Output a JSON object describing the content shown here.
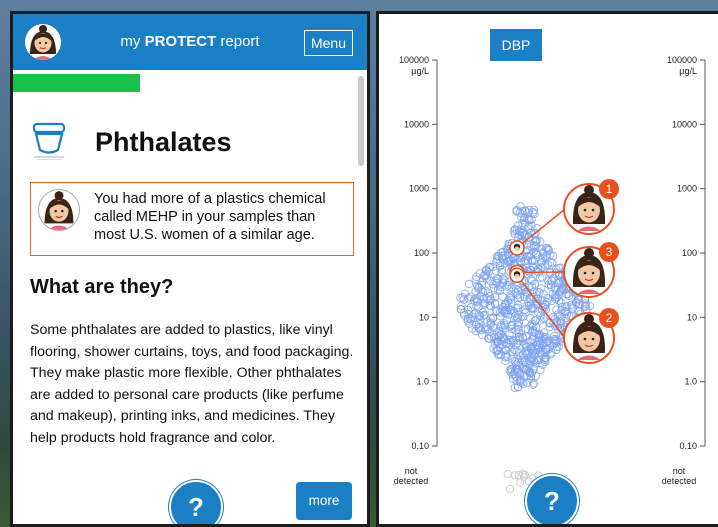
{
  "header": {
    "title_prefix": "my ",
    "title_bold": "PROTECT",
    "title_suffix": " report",
    "menu_label": "Menu",
    "color": "#1a7fc4"
  },
  "progress": {
    "fraction": 0.36,
    "color": "#17c24a"
  },
  "page": {
    "title": "Phthalates",
    "icon": "plastic-container-icon",
    "result_text": "You had more of a plastics chemical called MEHP in your samples than most U.S. women of a similar age.",
    "section_title": "What are they?",
    "body": "Some phthalates are added to plastics, like vinyl flooring, shower curtains, toys, and food packaging. They make plastic more flexible. Other phthalates are added to personal care products (like perfume and makeup), printing inks, and medicines. They help products hold fragrance and color.",
    "help_label": "?",
    "more_label": "more"
  },
  "chart": {
    "tab_label": "DBP",
    "unit_label": "µg/L",
    "axis_ticks": [
      "100000",
      "10000",
      "1000",
      "100",
      "10",
      "1.0",
      "0.10"
    ],
    "not_detected_line1": "not",
    "not_detected_line2": "detected",
    "help_label": "?",
    "accent_color": "#e8501d",
    "dot_color": "#7da2ee",
    "samples": [
      {
        "label": "1",
        "value": 120
      },
      {
        "label": "3",
        "value": 50
      },
      {
        "label": "2",
        "value": 45
      }
    ]
  }
}
